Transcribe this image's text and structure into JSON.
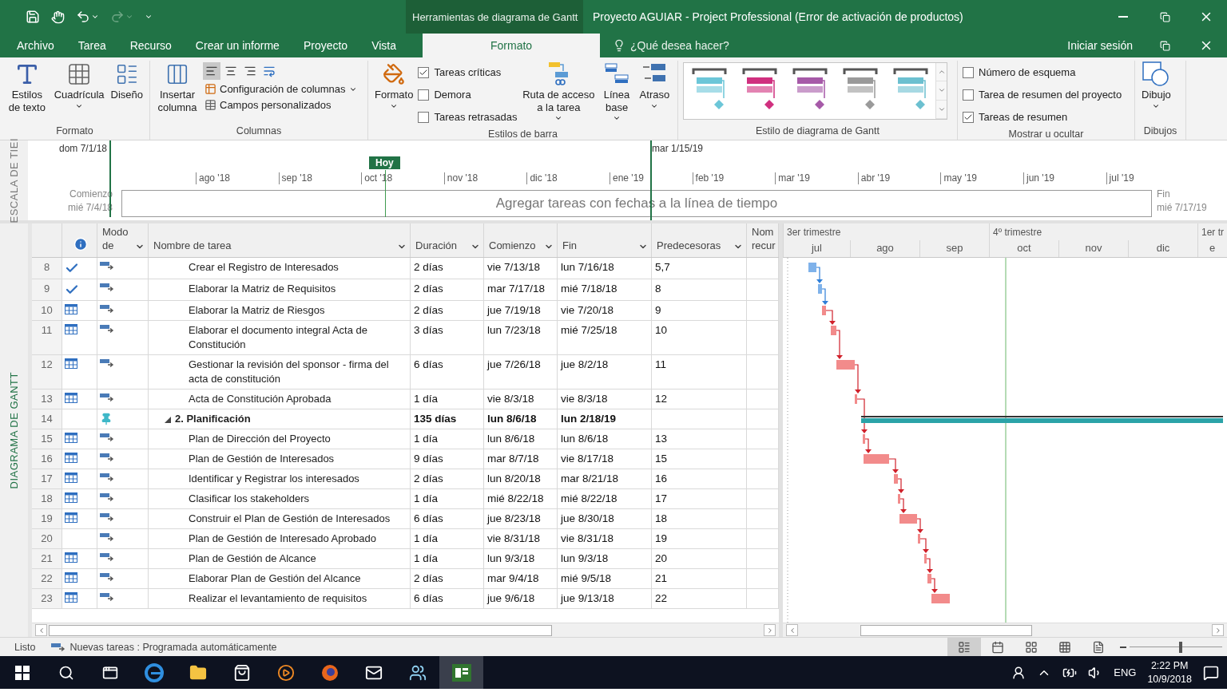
{
  "title_bar": {
    "context_tab": "Herramientas de diagrama de Gantt",
    "title": "Proyecto AGUIAR - Project Professional (Error de activación de productos)"
  },
  "tabs": [
    {
      "label": "Archivo",
      "selected": false
    },
    {
      "label": "Tarea",
      "selected": false
    },
    {
      "label": "Recurso",
      "selected": false
    },
    {
      "label": "Crear un informe",
      "selected": false
    },
    {
      "label": "Proyecto",
      "selected": false
    },
    {
      "label": "Vista",
      "selected": false
    },
    {
      "label": "Formato",
      "selected": true
    }
  ],
  "tell_me": {
    "placeholder": "¿Qué desea hacer?"
  },
  "sign_in": "Iniciar sesión",
  "ribbon": {
    "format_group": {
      "label": "Formato",
      "buttons": [
        {
          "kind": "text-styles",
          "label": "Estilos de texto",
          "dropdown": false
        },
        {
          "kind": "gridlines",
          "label": "Cuadrícula",
          "dropdown": true
        },
        {
          "kind": "layout",
          "label": "Diseño",
          "dropdown": false
        }
      ]
    },
    "columns_group": {
      "label": "Columnas",
      "insert_button": "Insertar columna",
      "align": [
        {
          "kind": "left",
          "selected": true
        },
        {
          "kind": "center",
          "selected": false
        },
        {
          "kind": "right",
          "selected": false
        },
        {
          "kind": "wrap",
          "selected": false
        }
      ],
      "commands": [
        {
          "kind": "column-settings",
          "label": "Configuración de columnas",
          "dropdown": true
        },
        {
          "kind": "custom-fields",
          "label": "Campos personalizados",
          "dropdown": false
        }
      ]
    },
    "bar_styles_group": {
      "label": "Estilos de barra",
      "format_button": {
        "label": "Formato",
        "dropdown": true
      },
      "checkboxes": [
        {
          "label": "Tareas críticas",
          "checked": true
        },
        {
          "label": "Demora",
          "checked": false
        },
        {
          "label": "Tareas retrasadas",
          "checked": false
        }
      ],
      "buttons": [
        {
          "kind": "task-path",
          "label": "Ruta de acceso a la tarea",
          "dropdown": true
        },
        {
          "kind": "baseline",
          "label": "Línea base",
          "dropdown": true
        },
        {
          "kind": "slippage",
          "label": "Atraso",
          "dropdown": true
        }
      ]
    },
    "gantt_style_group": {
      "label": "Estilo de diagrama de Gantt",
      "styles": [
        {
          "color": "#6cc6d8"
        },
        {
          "color": "#d0307f"
        },
        {
          "color": "#a65aa8"
        },
        {
          "color": "#9a9a9a"
        },
        {
          "color": "#6cc0d0"
        }
      ]
    },
    "show_hide_group": {
      "label": "Mostrar u ocultar",
      "checkboxes": [
        {
          "label": "Número de esquema",
          "checked": false
        },
        {
          "label": "Tarea de resumen del proyecto",
          "checked": false
        },
        {
          "label": "Tareas de resumen",
          "checked": true
        }
      ]
    },
    "drawings_group": {
      "label": "Dibujos",
      "button": {
        "label": "Dibujo",
        "dropdown": true
      }
    }
  },
  "timeline": {
    "side_label": "ESCALA DE TIEI",
    "view_start": "dom 7/1/18",
    "marker": "mar 1/15/19",
    "today": "Hoy",
    "months": [
      "ago '18",
      "sep '18",
      "oct '18",
      "nov '18",
      "dic '18",
      "ene '19",
      "feb '19",
      "mar '19",
      "abr '19",
      "may '19",
      "jun '19",
      "jul '19"
    ],
    "start_label": "Comienzo",
    "start_date": "mié 7/4/18",
    "placeholder": "Agregar tareas con fechas a la línea de tiempo",
    "finish_label": "Fin",
    "finish_date": "mié 7/17/19"
  },
  "side_label": "DIAGRAMA DE GANTT",
  "table": {
    "columns": [
      {
        "kind": "info"
      },
      {
        "kind": "text",
        "label": "Modo de",
        "dropdown": true
      },
      {
        "kind": "text",
        "label": "Nombre de tarea",
        "dropdown": true
      },
      {
        "kind": "text",
        "label": "Duración",
        "dropdown": true
      },
      {
        "kind": "text",
        "label": "Comienzo",
        "dropdown": true
      },
      {
        "kind": "text",
        "label": "Fin",
        "dropdown": true
      },
      {
        "kind": "text",
        "label": "Predecesoras",
        "dropdown": true
      },
      {
        "kind": "text",
        "label": "Nom recur",
        "dropdown": false
      }
    ],
    "rows": [
      {
        "id": "8",
        "kind": "done",
        "manual": false,
        "name": "Crear el Registro de Interesados",
        "duration": "2 días",
        "start": "vie 7/13/18",
        "finish": "lun 7/16/18",
        "predecessors": "5,7"
      },
      {
        "id": "9",
        "kind": "done",
        "manual": false,
        "name": "Elaborar la Matriz de Requisitos",
        "duration": "2 días",
        "start": "mar 7/17/18",
        "finish": "mié 7/18/18",
        "predecessors": "8"
      },
      {
        "id": "10",
        "kind": "calendar",
        "manual": false,
        "name": "Elaborar la Matriz de Riesgos",
        "duration": "2 días",
        "start": "jue 7/19/18",
        "finish": "vie 7/20/18",
        "predecessors": "9"
      },
      {
        "id": "11",
        "kind": "calendar",
        "manual": false,
        "name": "Elaborar el documento integral Acta de Constitución",
        "duration": "3 días",
        "start": "lun 7/23/18",
        "finish": "mié 7/25/18",
        "predecessors": "10"
      },
      {
        "id": "12",
        "kind": "calendar",
        "manual": false,
        "name": "Gestionar la revisión del sponsor - firma del acta de constitución",
        "duration": "6 días",
        "start": "jue 7/26/18",
        "finish": "jue 8/2/18",
        "predecessors": "11"
      },
      {
        "id": "13",
        "kind": "calendar",
        "manual": false,
        "name": "Acta de Constitución Aprobada",
        "duration": "1 día",
        "start": "vie 8/3/18",
        "finish": "vie 8/3/18",
        "predecessors": "12"
      },
      {
        "id": "14",
        "kind": "summary",
        "manual": true,
        "name": "2. Planificación",
        "duration": "135 días",
        "start": "lun 8/6/18",
        "finish": "lun 2/18/19",
        "expanded": true,
        "children": [
          {
            "id": "15",
            "kind": "calendar",
            "manual": false,
            "name": "Plan de Dirección del Proyecto",
            "duration": "1 día",
            "start": "lun 8/6/18",
            "finish": "lun 8/6/18",
            "predecessors": "13"
          },
          {
            "id": "16",
            "kind": "calendar",
            "manual": false,
            "name": "Plan de Gestión de Interesados",
            "duration": "9 días",
            "start": "mar 8/7/18",
            "finish": "vie 8/17/18",
            "predecessors": "15"
          },
          {
            "id": "17",
            "kind": "calendar",
            "manual": false,
            "name": "Identificar y Registrar los interesados",
            "duration": "2 días",
            "start": "lun 8/20/18",
            "finish": "mar 8/21/18",
            "predecessors": "16"
          },
          {
            "id": "18",
            "kind": "calendar",
            "manual": false,
            "name": "Clasificar los stakeholders",
            "duration": "1 día",
            "start": "mié 8/22/18",
            "finish": "mié 8/22/18",
            "predecessors": "17"
          },
          {
            "id": "19",
            "kind": "calendar",
            "manual": false,
            "name": "Construir el Plan de Gestión de Interesados",
            "duration": "6 días",
            "start": "jue 8/23/18",
            "finish": "jue 8/30/18",
            "predecessors": "18"
          },
          {
            "id": "20",
            "kind": "plain",
            "manual": false,
            "name": "Plan de Gestión de Interesado Aprobado",
            "duration": "1 día",
            "start": "vie 8/31/18",
            "finish": "vie 8/31/18",
            "predecessors": "19"
          },
          {
            "id": "21",
            "kind": "calendar",
            "manual": false,
            "name": "Plan de Gestión de Alcance",
            "duration": "1 día",
            "start": "lun 9/3/18",
            "finish": "lun 9/3/18",
            "predecessors": "20"
          },
          {
            "id": "22",
            "kind": "calendar",
            "manual": false,
            "name": "Elaborar Plan de Gestión del Alcance",
            "duration": "2 días",
            "start": "mar 9/4/18",
            "finish": "mié 9/5/18",
            "predecessors": "21"
          },
          {
            "id": "23",
            "kind": "calendar",
            "manual": false,
            "name": "Realizar el levantamiento de requisitos",
            "duration": "6 días",
            "start": "jue 9/6/18",
            "finish": "jue 9/13/18",
            "predecessors": "22"
          }
        ]
      }
    ]
  },
  "gantt": {
    "quarters": [
      "3er trimestre",
      "4º trimestre",
      "1er tr"
    ],
    "months": [
      "jul",
      "ago",
      "sep",
      "oct",
      "nov",
      "dic",
      "e"
    ]
  },
  "status_bar": {
    "status": "Listo",
    "new_tasks": "Nuevas tareas : Programada automáticamente",
    "views": [
      {
        "kind": "gantt",
        "selected": true
      },
      {
        "kind": "usage",
        "selected": false
      },
      {
        "kind": "planner",
        "selected": false
      },
      {
        "kind": "sheet",
        "selected": false
      },
      {
        "kind": "report",
        "selected": false
      }
    ],
    "zoom": {
      "level": 0.55
    }
  },
  "taskbar": {
    "apps": [
      {
        "kind": "start",
        "selected": false
      },
      {
        "kind": "search",
        "selected": false
      },
      {
        "kind": "task-view",
        "selected": false
      },
      {
        "kind": "browser",
        "selected": false
      },
      {
        "kind": "folder",
        "selected": false
      },
      {
        "kind": "store",
        "selected": false
      },
      {
        "kind": "media",
        "selected": false
      },
      {
        "kind": "firefox",
        "selected": false
      },
      {
        "kind": "mail",
        "selected": false
      },
      {
        "kind": "people",
        "selected": false
      },
      {
        "kind": "project",
        "selected": true
      }
    ],
    "language": "ENG",
    "time": "2:22 PM",
    "date": "10/9/2018"
  }
}
